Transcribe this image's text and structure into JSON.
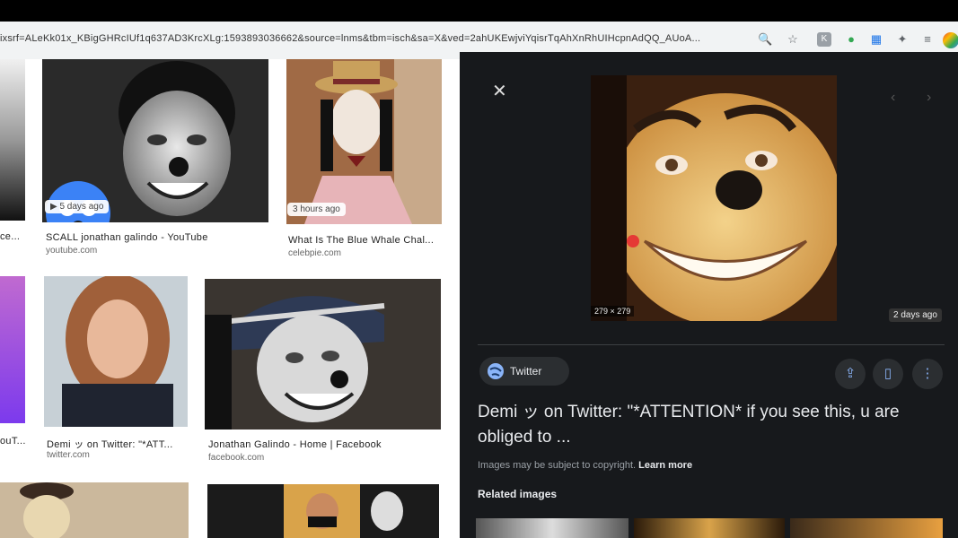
{
  "browser": {
    "url": "ixsrf=ALeKk01x_KBigGHRcIUf1q637AD3KrcXLg:1593893036662&source=lnms&tbm=isch&sa=X&ved=2ahUKEwjviYqisrTqAhXnRhUIHcpnAdQQ_AUoA...",
    "icons": [
      "zoom-icon",
      "star-icon",
      "extension-k-icon",
      "extension-green-icon",
      "extension-grid-icon",
      "puzzle-icon",
      "playlist-icon",
      "profile-avatar-icon"
    ]
  },
  "results": [
    {
      "caption": "SCALL jonathan galindo - YouTube",
      "domain": "youtube.com",
      "badge": "▶ 5 days ago"
    },
    {
      "caption": "What Is The Blue Whale Chal...",
      "domain": "celebpie.com",
      "badge": "3 hours ago"
    },
    {
      "caption": "Demi ッ on Twitter: \"*ATT...",
      "domain": "twitter.com",
      "badge": ""
    },
    {
      "caption": "Jonathan Galindo - Home | Facebook",
      "domain": "facebook.com",
      "badge": ""
    },
    {
      "caption": "ce...",
      "domain": "",
      "badge": ""
    },
    {
      "caption": "ouT...",
      "domain": "",
      "badge": ""
    }
  ],
  "panel": {
    "close_icon": "✕",
    "dimensions": "279 × 279",
    "age": "2 days ago",
    "source": "Twitter",
    "title": "Demi ッ on Twitter: \"*ATTENTION* if you see this, u are obliged to ...",
    "copyright_text": "Images may be subject to copyright.",
    "learn_more": "Learn more",
    "related_heading": "Related images"
  },
  "colors": {
    "panel_bg": "#17191c",
    "accent": "#8ab4f8"
  }
}
